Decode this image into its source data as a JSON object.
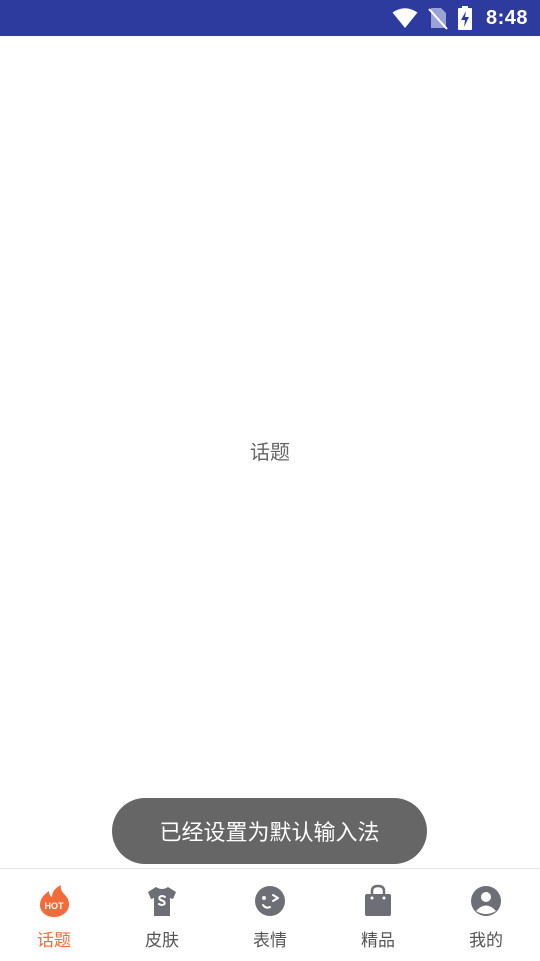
{
  "status_bar": {
    "time": "8:48",
    "icons": [
      "wifi-icon",
      "no-sim-icon",
      "battery-charging-icon"
    ]
  },
  "main": {
    "label": "话题"
  },
  "toast": {
    "message": "已经设置为默认输入法"
  },
  "bottom_nav": {
    "active_index": 0,
    "active_color": "#f46b3a",
    "inactive_color": "#555555",
    "items": [
      {
        "label": "话题",
        "icon": "hot-flame-icon",
        "badge_text": "HOT"
      },
      {
        "label": "皮肤",
        "icon": "tshirt-icon"
      },
      {
        "label": "表情",
        "icon": "wink-face-icon"
      },
      {
        "label": "精品",
        "icon": "shopping-bag-icon"
      },
      {
        "label": "我的",
        "icon": "user-avatar-icon"
      }
    ]
  },
  "colors": {
    "status_bar": "#2e3b9e",
    "toast_bg": "#666666",
    "icon_gray": "#6e6e76"
  }
}
